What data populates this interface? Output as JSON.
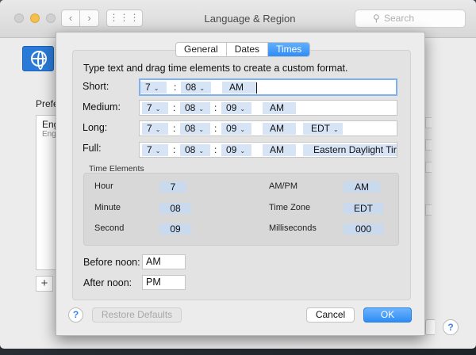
{
  "window": {
    "title": "Language & Region",
    "back_label": "‹",
    "forward_label": "›",
    "grid_label": "⋮⋮⋮",
    "search_placeholder": "Search",
    "preferred_label": "Prefe",
    "list_item_primary": "Eng",
    "list_item_secondary": "Eng",
    "add_label": "+",
    "help_label": "?"
  },
  "sheet": {
    "tabs": [
      "General",
      "Dates",
      "Times"
    ],
    "active_tab": "Times",
    "instructions": "Type text and drag time elements to create a custom format.",
    "formats": {
      "short": {
        "label": "Short:",
        "hour": "7",
        "minute": "08",
        "ampm": "AM"
      },
      "medium": {
        "label": "Medium:",
        "hour": "7",
        "minute": "08",
        "second": "09",
        "ampm": "AM"
      },
      "long": {
        "label": "Long:",
        "hour": "7",
        "minute": "08",
        "second": "09",
        "ampm": "AM",
        "timezone": "EDT"
      },
      "full": {
        "label": "Full:",
        "hour": "7",
        "minute": "08",
        "second": "09",
        "ampm": "AM",
        "timezone": "Eastern Daylight Tir"
      }
    },
    "time_elements": {
      "title": "Time Elements",
      "hour_label": "Hour",
      "hour_value": "7",
      "minute_label": "Minute",
      "minute_value": "08",
      "second_label": "Second",
      "second_value": "09",
      "ampm_label": "AM/PM",
      "ampm_value": "AM",
      "timezone_label": "Time Zone",
      "timezone_value": "EDT",
      "ms_label": "Milliseconds",
      "ms_value": "000"
    },
    "before_noon_label": "Before noon:",
    "before_noon_value": "AM",
    "after_noon_label": "After noon:",
    "after_noon_value": "PM",
    "help_label": "?",
    "restore_label": "Restore Defaults",
    "cancel_label": "Cancel",
    "ok_label": "OK"
  },
  "colors": {
    "accent": "#2f8ef6",
    "token_bg": "#d6e4f5",
    "focus_ring": "#7eb2ef"
  }
}
